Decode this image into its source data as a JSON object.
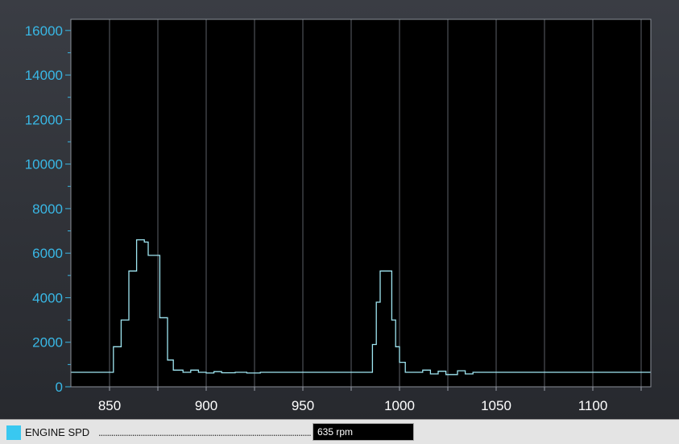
{
  "chart_data": {
    "type": "line",
    "xlim": [
      830,
      1130
    ],
    "ylim": [
      0,
      16500
    ],
    "x_ticks": [
      850,
      900,
      950,
      1000,
      1050,
      1100
    ],
    "y_ticks": [
      0,
      2000,
      4000,
      6000,
      8000,
      10000,
      12000,
      14000,
      16000
    ],
    "grid": true,
    "line_color": "#9fe6f2",
    "axis_label_color": "#39b8e6",
    "series": [
      {
        "name": "ENGINE SPD",
        "step": true,
        "points": [
          [
            830,
            650
          ],
          [
            852,
            650
          ],
          [
            852,
            1800
          ],
          [
            856,
            1800
          ],
          [
            856,
            3000
          ],
          [
            860,
            3000
          ],
          [
            860,
            5200
          ],
          [
            864,
            5200
          ],
          [
            864,
            6600
          ],
          [
            868,
            6600
          ],
          [
            868,
            6500
          ],
          [
            870,
            6500
          ],
          [
            870,
            5900
          ],
          [
            876,
            5900
          ],
          [
            876,
            3100
          ],
          [
            880,
            3100
          ],
          [
            880,
            1200
          ],
          [
            883,
            1200
          ],
          [
            883,
            750
          ],
          [
            888,
            750
          ],
          [
            888,
            650
          ],
          [
            892,
            650
          ],
          [
            892,
            750
          ],
          [
            896,
            750
          ],
          [
            896,
            650
          ],
          [
            900,
            650
          ],
          [
            900,
            620
          ],
          [
            904,
            620
          ],
          [
            904,
            680
          ],
          [
            908,
            680
          ],
          [
            908,
            630
          ],
          [
            915,
            630
          ],
          [
            915,
            650
          ],
          [
            921,
            650
          ],
          [
            921,
            620
          ],
          [
            928,
            620
          ],
          [
            928,
            650
          ],
          [
            986,
            650
          ],
          [
            986,
            1900
          ],
          [
            988,
            1900
          ],
          [
            988,
            3800
          ],
          [
            990,
            3800
          ],
          [
            990,
            5200
          ],
          [
            996,
            5200
          ],
          [
            996,
            3000
          ],
          [
            998,
            3000
          ],
          [
            998,
            1800
          ],
          [
            1000,
            1800
          ],
          [
            1000,
            1100
          ],
          [
            1003,
            1100
          ],
          [
            1003,
            650
          ],
          [
            1012,
            650
          ],
          [
            1012,
            750
          ],
          [
            1016,
            750
          ],
          [
            1016,
            580
          ],
          [
            1020,
            580
          ],
          [
            1020,
            700
          ],
          [
            1024,
            700
          ],
          [
            1024,
            550
          ],
          [
            1030,
            550
          ],
          [
            1030,
            720
          ],
          [
            1034,
            720
          ],
          [
            1034,
            580
          ],
          [
            1038,
            580
          ],
          [
            1038,
            650
          ],
          [
            1130,
            650
          ]
        ]
      }
    ]
  },
  "legend": {
    "label": "ENGINE SPD",
    "dots": "........................................................................................................",
    "swatch_color": "#39c8f0"
  },
  "readout": {
    "value": "635 rpm"
  }
}
